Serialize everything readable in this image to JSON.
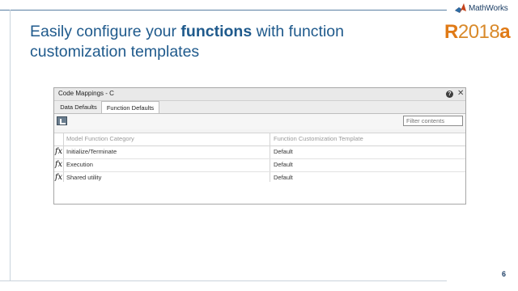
{
  "slide": {
    "title_pre": "Easily configure your ",
    "title_bold": "functions",
    "title_post": " with function customization templates",
    "logo_text": "MathWorks",
    "release_r": "R",
    "release_year": "2018",
    "release_a": "a",
    "page_number": "6"
  },
  "window": {
    "title": "Code Mappings - C",
    "help_glyph": "?",
    "close_glyph": "✕"
  },
  "tabs": [
    {
      "label": "Data Defaults",
      "active": false
    },
    {
      "label": "Function Defaults",
      "active": true
    }
  ],
  "toolbar": {
    "filter_placeholder": "Filter contents"
  },
  "table": {
    "columns": [
      "Model Function Category",
      "Function Customization Template"
    ],
    "fx_glyph": "fx",
    "rows": [
      {
        "category": "Initialize/Terminate",
        "template": "Default"
      },
      {
        "category": "Execution",
        "template": "Default"
      },
      {
        "category": "Shared utility",
        "template": "Default"
      }
    ]
  },
  "colors": {
    "title_blue": "#1f5a8c",
    "release_orange": "#e07a16"
  }
}
